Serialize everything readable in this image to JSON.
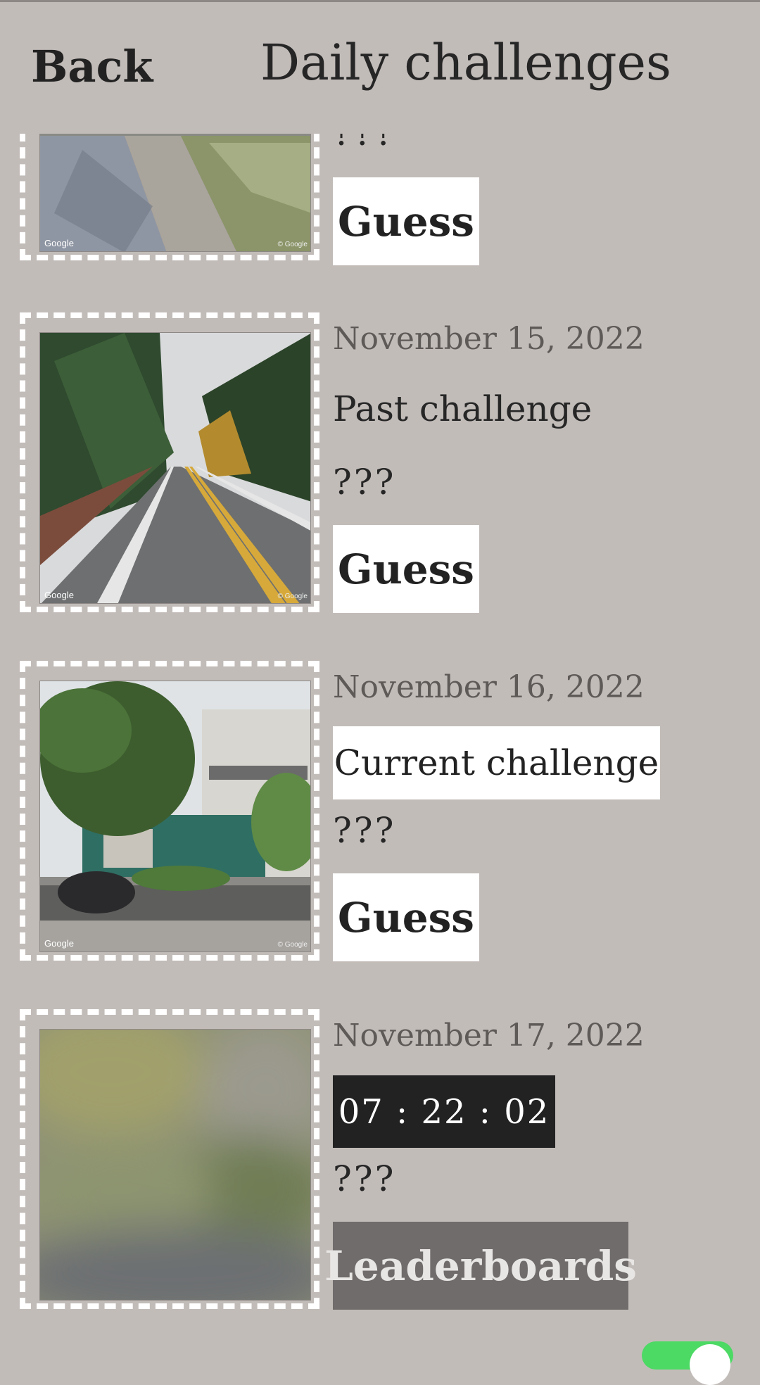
{
  "header": {
    "back_label": "Back",
    "title": "Daily challenges"
  },
  "challenges": [
    {
      "date": "",
      "status": "",
      "answer": "???",
      "button": "Guess"
    },
    {
      "date": "November 15, 2022",
      "status": "Past challenge",
      "answer": "???",
      "button": "Guess"
    },
    {
      "date": "November 16, 2022",
      "status": "Current challenge",
      "answer": "???",
      "button": "Guess"
    },
    {
      "date": "November 17, 2022",
      "countdown": "07 : 22 : 02",
      "answer": "???",
      "button": "Leaderboards"
    }
  ],
  "watermark": {
    "left": "Google",
    "right": "© Google"
  },
  "toggle": {
    "state": "on"
  },
  "colors": {
    "background": "#c2bcb9",
    "button_bg": "#ffffff",
    "timer_bg": "#222222",
    "leaderboards_bg": "#6f6c6b",
    "toggle_on": "#4cd964"
  }
}
